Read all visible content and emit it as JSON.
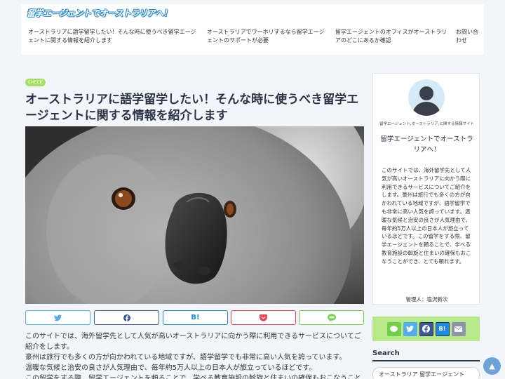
{
  "header": {
    "logo_text": "留学エージェントでオーストラリアへ！",
    "nav": [
      "オーストラリアに語学留学したい！そんな時に使うべき留学エージェントに関する情報を紹介します",
      "オーストラリアでワーホリするなら留学エージェントのサポートが必要",
      "留学エージェントのオフィスがオーストラリアのどこにあるか確認",
      "お問い合わせ"
    ]
  },
  "article": {
    "category": "CHECK",
    "title": "オーストラリアに語学留学したい！そんな時に使うべき留学エージェントに関する情報を紹介します",
    "hero_image": "koala-photo",
    "share": {
      "twitter": "twitter-icon",
      "facebook": "facebook-icon",
      "hatena": "B!",
      "pocket": "pocket-icon",
      "line": "line-icon"
    },
    "paragraphs": [
      "このサイトでは、海外留学先として人気が高いオーストラリアに向かう際に利用できるサービスについてご紹介をします。",
      "豪州は旅行でも多くの方が向かわれている地域ですが、語学留学でも非常に高い人気を誇っています。",
      "温暖な気候と治安の良さが人気理由で、毎年約5万人以上の日本人が旅立っているほどです。",
      "この留学をする際、留学エージェントを頼ることで、学べる教育施設の斡旋と住まいの確保もおこなうこと"
    ]
  },
  "profile": {
    "subtitle": "留学エージェント,オーストラリア,に関する情報サイト",
    "name": "留学エージェントでオーストラリアへ！",
    "description": "このサイトでは、海外留学先として人気が高いオーストラリアに向かう際に利用できるサービスについてご紹介をします。豪州は旅行でも多くの方が向かわれている地域ですが、語学留学でも非常に高い人気を誇っています。温暖な気候と治安の良さが人気理由で、毎年約5万人以上の日本人が旅立っているほどです。この留学をする際、留学エージェントを頼ることで、学べる教育施設の斡旋と住まいの確保もおこなうことができ、とても頼れます。",
    "admin": "管理人：塩沢新次"
  },
  "follow": {
    "hatena": "B!"
  },
  "search": {
    "heading": "Search",
    "value": "オーストラリア 留学エージェント"
  },
  "colors": {
    "accent_green": "#a8de64",
    "follow_bg": "#b7e88a",
    "title_navy": "#2b3346"
  }
}
